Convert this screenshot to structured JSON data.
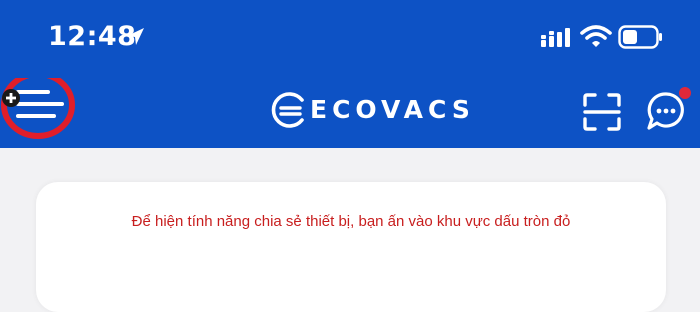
{
  "status_bar": {
    "time": "12:48",
    "icons": [
      "location-arrow-icon",
      "cellular-signal-icon",
      "wifi-icon",
      "battery-icon"
    ]
  },
  "header": {
    "brand": "ECOVACS",
    "icons": [
      "menu-icon",
      "scan-icon",
      "chat-icon"
    ],
    "notification_dot": true
  },
  "annotation": {
    "highlight": "menu-button",
    "color": "#e01e2a",
    "instruction": "Để hiện tính năng chia sẻ thiết bị, bạn ấn vào khu vực dấu tròn đỏ"
  },
  "colors": {
    "header_bg": "#0d52c5",
    "page_bg": "#f2f2f4",
    "instruction_text": "#c81e1e",
    "notification_dot": "#e0283a"
  }
}
